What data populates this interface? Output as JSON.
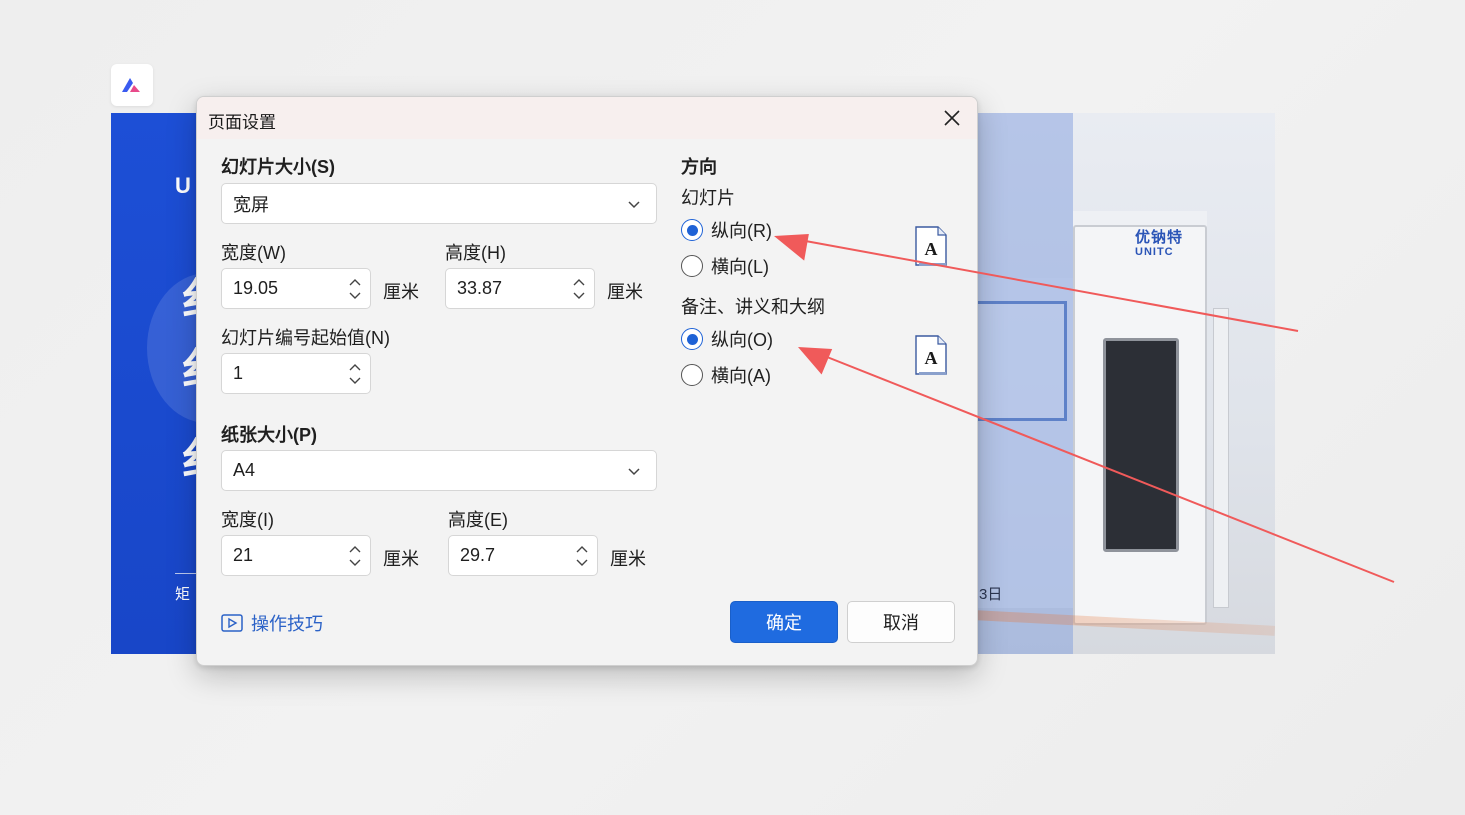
{
  "dialog": {
    "title": "页面设置",
    "slide_size": {
      "label": "幻灯片大小(S)",
      "value": "宽屏",
      "width_label": "宽度(W)",
      "width_value": "19.05",
      "height_label": "高度(H)",
      "height_value": "33.87",
      "unit": "厘米",
      "start_number_label": "幻灯片编号起始值(N)",
      "start_number_value": "1"
    },
    "paper_size": {
      "label": "纸张大小(P)",
      "value": "A4",
      "width_label": "宽度(I)",
      "width_value": "21",
      "height_label": "高度(E)",
      "height_value": "29.7",
      "unit": "厘米"
    },
    "orientation": {
      "heading": "方向",
      "slides_label": "幻灯片",
      "slides_portrait": "纵向(R)",
      "slides_landscape": "横向(L)",
      "slides_selected": "portrait",
      "notes_label": "备注、讲义和大纲",
      "notes_portrait": "纵向(O)",
      "notes_landscape": "横向(A)",
      "notes_selected": "portrait",
      "page_icon_letter": "A"
    },
    "tips_link": "操作技巧",
    "ok_button": "确定",
    "cancel_button": "取消"
  },
  "background": {
    "left_slide_fragment": "矩",
    "right_slide_fragment": "3日",
    "brand_cn": "优钠特",
    "brand_en": "UNITC"
  },
  "colors": {
    "accent": "#1f6be0",
    "link": "#2b62c7",
    "annotation_arrow": "#f05a5a"
  }
}
